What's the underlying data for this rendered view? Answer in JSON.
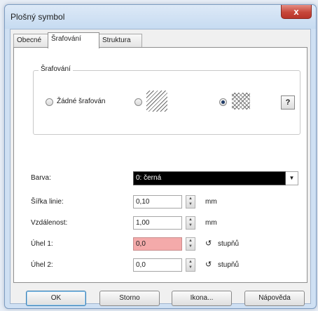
{
  "window": {
    "title": "Plošný symbol",
    "close_label": "x"
  },
  "tabs": [
    {
      "label": "Obecné"
    },
    {
      "label": "Šrafování"
    },
    {
      "label": "Struktura"
    }
  ],
  "hatching": {
    "group_label": "Šrafování",
    "no_hatch_label": "Žádné šrafován",
    "selected_option": "cross-hatch",
    "help_label": "?"
  },
  "fields": {
    "color": {
      "label": "Barva:",
      "value": "0: černá"
    },
    "line_width": {
      "label": "Šířka linie:",
      "value": "0,10",
      "unit": "mm"
    },
    "spacing": {
      "label": "Vzdálenost:",
      "value": "1,00",
      "unit": "mm"
    },
    "angle1": {
      "label": "Úhel 1:",
      "value": "0,0",
      "unit": "stupňů",
      "error_color": "#f4aaaa"
    },
    "angle2": {
      "label": "Úhel 2:",
      "value": "0,0",
      "unit": "stupňů"
    }
  },
  "buttons": {
    "ok": "OK",
    "cancel": "Storno",
    "icon": "Ikona...",
    "help": "Nápověda"
  }
}
